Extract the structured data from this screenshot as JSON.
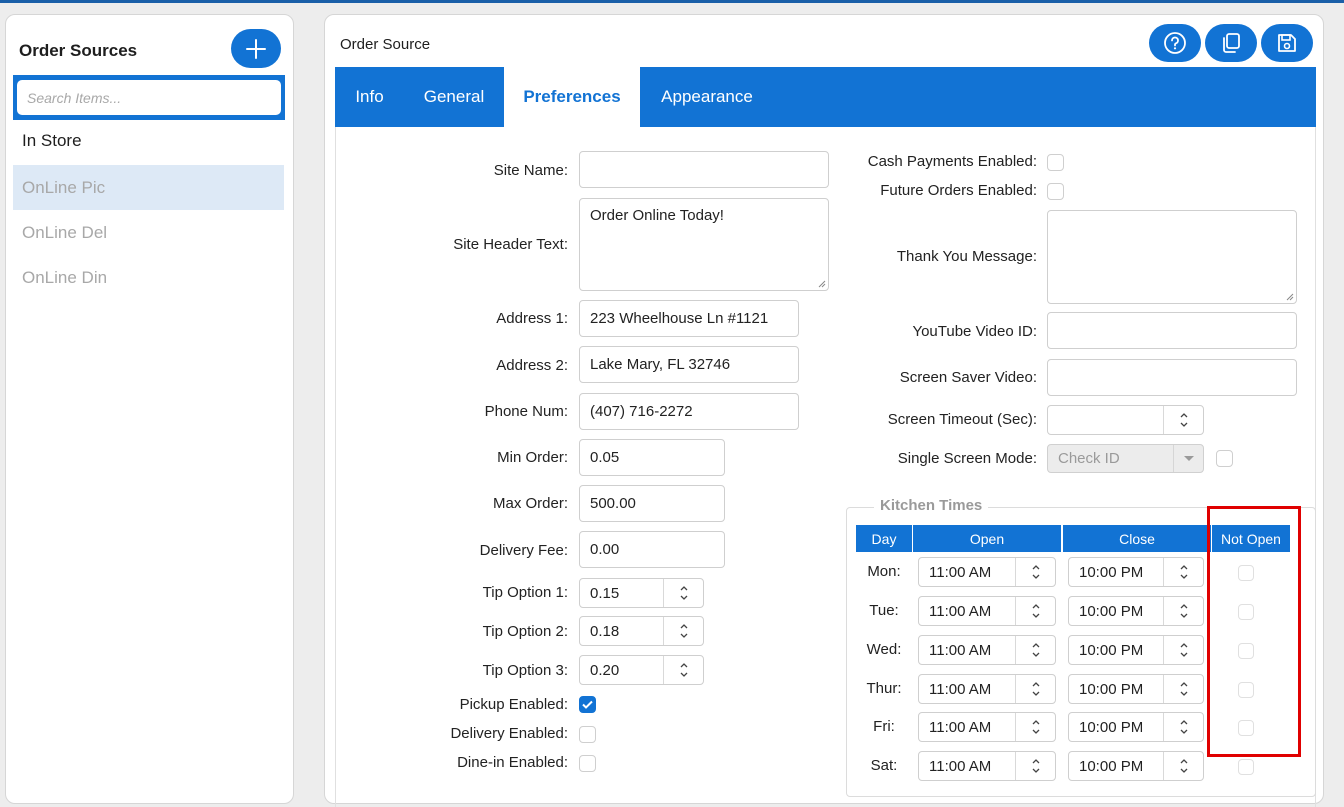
{
  "sidebar": {
    "title": "Order Sources",
    "search_placeholder": "Search Items...",
    "items": [
      {
        "label": "In Store"
      },
      {
        "label": "OnLine Pic"
      },
      {
        "label": "OnLine Del"
      },
      {
        "label": "OnLine Din"
      }
    ]
  },
  "panel": {
    "title": "Order Source",
    "tabs": [
      "Info",
      "General",
      "Preferences",
      "Appearance"
    ],
    "active_tab": "Preferences"
  },
  "form_left": {
    "site_name_label": "Site Name:",
    "site_name_value": "",
    "site_header_label": "Site Header Text:",
    "site_header_value": "Order Online Today!",
    "address1_label": "Address 1:",
    "address1_value": "223 Wheelhouse Ln #1121",
    "address2_label": "Address 2:",
    "address2_value": "Lake Mary, FL 32746",
    "phone_label": "Phone Num:",
    "phone_value": "(407) 716-2272",
    "min_order_label": "Min Order:",
    "min_order_value": "0.05",
    "max_order_label": "Max Order:",
    "max_order_value": "500.00",
    "delivery_fee_label": "Delivery Fee:",
    "delivery_fee_value": "0.00",
    "tip1_label": "Tip Option 1:",
    "tip1_value": "0.15",
    "tip2_label": "Tip Option 2:",
    "tip2_value": "0.18",
    "tip3_label": "Tip Option 3:",
    "tip3_value": "0.20",
    "pickup_label": "Pickup Enabled:",
    "pickup_checked": true,
    "delivery_label": "Delivery Enabled:",
    "delivery_checked": false,
    "dinein_label": "Dine-in Enabled:",
    "dinein_checked": false
  },
  "form_right": {
    "cash_label": "Cash Payments Enabled:",
    "future_label": "Future Orders Enabled:",
    "thank_you_label": "Thank You Message:",
    "youtube_label": "YouTube Video ID:",
    "screensaver_label": "Screen Saver Video:",
    "timeout_label": "Screen Timeout (Sec):",
    "timeout_value": "",
    "single_screen_label": "Single Screen Mode:",
    "single_screen_value": "Check ID"
  },
  "kitchen": {
    "legend": "Kitchen Times",
    "headers": [
      "Day",
      "Open",
      "Close",
      "Not Open"
    ],
    "rows": [
      {
        "day": "Mon:",
        "open": "11:00 AM",
        "close": "10:00 PM"
      },
      {
        "day": "Tue:",
        "open": "11:00 AM",
        "close": "10:00 PM"
      },
      {
        "day": "Wed:",
        "open": "11:00 AM",
        "close": "10:00 PM"
      },
      {
        "day": "Thur:",
        "open": "11:00 AM",
        "close": "10:00 PM"
      },
      {
        "day": "Fri:",
        "open": "11:00 AM",
        "close": "10:00 PM"
      },
      {
        "day": "Sat:",
        "open": "11:00 AM",
        "close": "10:00 PM"
      }
    ]
  },
  "colors": {
    "accent": "#1273d4",
    "highlight": "#e00000"
  },
  "icons": [
    "plus-icon",
    "help-icon",
    "copy-icon",
    "save-icon"
  ]
}
